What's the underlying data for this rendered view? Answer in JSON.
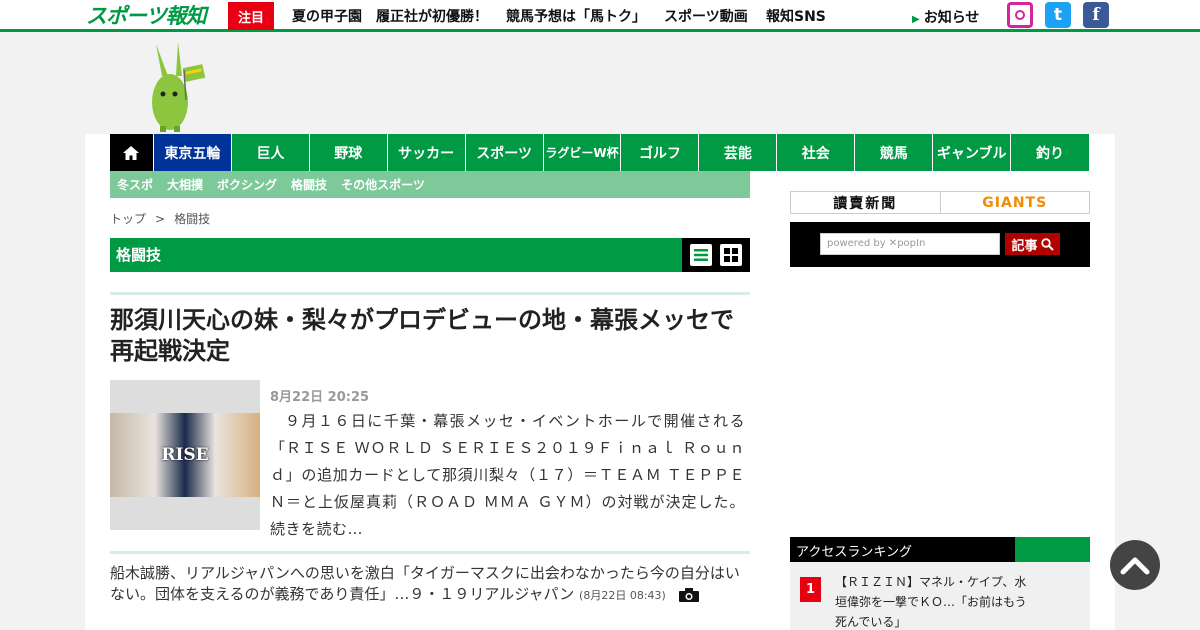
{
  "header": {
    "logo_text": "スポーツ報知",
    "chumoku_label": "注目",
    "links": [
      "夏の甲子園",
      "履正社が初優勝！",
      "競馬予想は「馬トク」",
      "スポーツ動画",
      "報知SNS"
    ],
    "notice_label": "お知らせ",
    "sns": {
      "twitter_glyph": "t",
      "facebook_glyph": "f"
    }
  },
  "nav": {
    "items": [
      "東京五輪",
      "巨人",
      "野球",
      "サッカー",
      "スポーツ",
      "ラグビーW杯",
      "ゴルフ",
      "芸能",
      "社会",
      "競馬",
      "ギャンブル",
      "釣り"
    ],
    "home_icon": "home-icon"
  },
  "subnav": {
    "items": [
      "冬スポ",
      "大相撲",
      "ボクシング",
      "格闘技",
      "その他スポーツ"
    ]
  },
  "breadcrumb": {
    "top": "トップ",
    "separator": ">",
    "current": "格闘技"
  },
  "section": {
    "title": "格闘技"
  },
  "article": {
    "headline": "那須川天心の妹・梨々がプロデビューの地・幕張メッセで再起戦決定",
    "date": "8月22日 20:25",
    "summary": "９月１６日に千葉・幕張メッセ・イベントホールで開催される「ＲＩＳＥ ＷＯＲＬＤ ＳＥＲＩＥＳ２０１９Ｆｉｎａｌ Ｒｏｕｎｄ」の追加カードとして那須川梨々（１７）＝ＴＥＡＭ ＴＥＰＰＥＮ＝と上仮屋真莉（ＲＯＡＤ ＭＭＡ ＧＹＭ）の対戦が決定した。 続きを読む…",
    "thumb_text": "RISE"
  },
  "article2": {
    "title": "船木誠勝、リアルジャパンへの思いを激白「タイガーマスクに出会わなかったら今の自分はいない。団体を支えるのが義務であり責任」…９・１９リアルジャパン",
    "date": "(8月22日 08:43)"
  },
  "sidebar": {
    "banner_yomiuri": "讀賣新聞",
    "banner_giants": "GIANTS",
    "search_placeholder": "powered by ✕popIn",
    "search_button": "記事",
    "ranking_title": "アクセスランキング",
    "rank1_num": "1",
    "rank1_text": "【ＲＩＺＩＮ】マネル・ケイプ、水垣偉弥を一撃でＫＯ…「お前はもう死んでいる」"
  },
  "colors": {
    "brand_green": "#009944",
    "accent_red": "#e60012",
    "tokyo_blue": "#003399"
  }
}
